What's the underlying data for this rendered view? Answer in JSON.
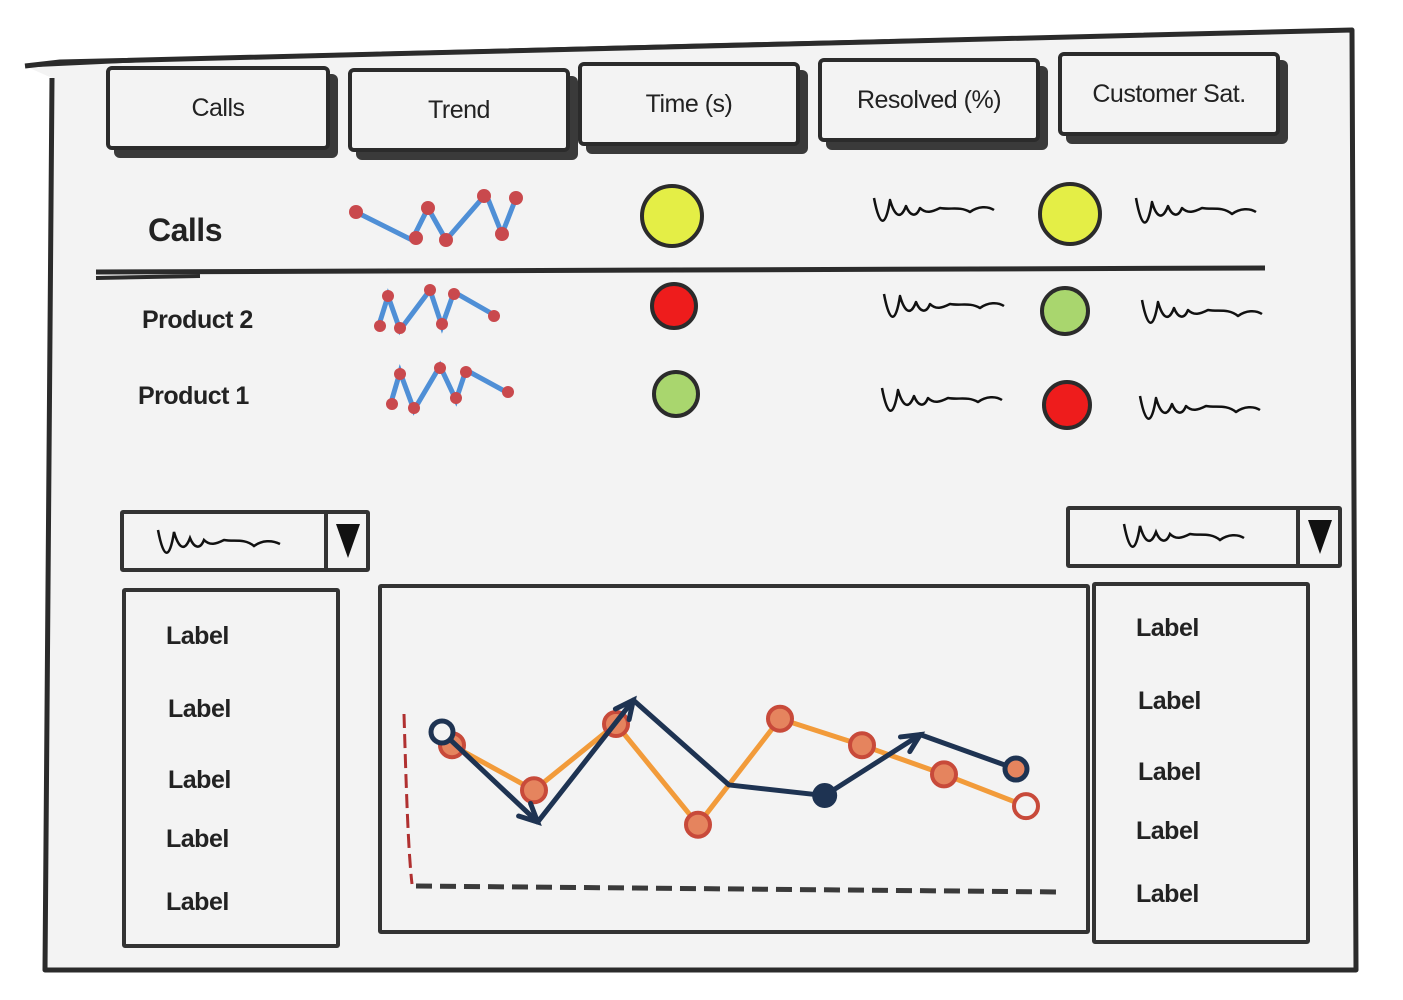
{
  "header": {
    "columns": [
      {
        "label": "Calls"
      },
      {
        "label": "Trend"
      },
      {
        "label": "Time (s)"
      },
      {
        "label": "Resolved (%)"
      },
      {
        "label": "Customer Sat."
      }
    ]
  },
  "rows": [
    {
      "label": "Calls",
      "time_status": "#e4ee46",
      "satisfaction_status": "#e4ee46"
    },
    {
      "label": "Product 2",
      "time_status": "#ee1c1c",
      "satisfaction_status": "#a9d66e"
    },
    {
      "label": "Product 1",
      "time_status": "#a9d66e",
      "satisfaction_status": "#ee1c1c"
    }
  ],
  "left_dropdown": {
    "icon": "squiggle-placeholder",
    "arrow": "triangle-down-icon"
  },
  "right_dropdown": {
    "icon": "squiggle-placeholder",
    "arrow": "triangle-down-icon"
  },
  "left_list": {
    "items": [
      "Label",
      "Label",
      "Label",
      "Label",
      "Label"
    ]
  },
  "right_list": {
    "items": [
      "Label",
      "Label",
      "Label",
      "Label",
      "Label"
    ]
  },
  "colors": {
    "sparkline_line": "#4f8fd6",
    "sparkline_point": "#c9494d",
    "series_orange": "#f29b3a",
    "series_navy": "#1e3352",
    "marker_fill": "#e5845e",
    "marker_ring": "#c84a3a",
    "axis_x": "#3a3a3a",
    "axis_y": "#b03030"
  },
  "chart_data": {
    "type": "line",
    "x": [
      1,
      2,
      3,
      4,
      5,
      6,
      7,
      8
    ],
    "series": [
      {
        "values": [
          4.5,
          2.8,
          5.3,
          1.5,
          5.5,
          4.5,
          3.4,
          2.2
        ]
      },
      {
        "values": [
          5.0,
          1.6,
          6.2,
          3.0,
          2.6,
          4.9,
          3.6
        ]
      }
    ],
    "xlabel": "",
    "ylabel": "",
    "grid": false
  }
}
